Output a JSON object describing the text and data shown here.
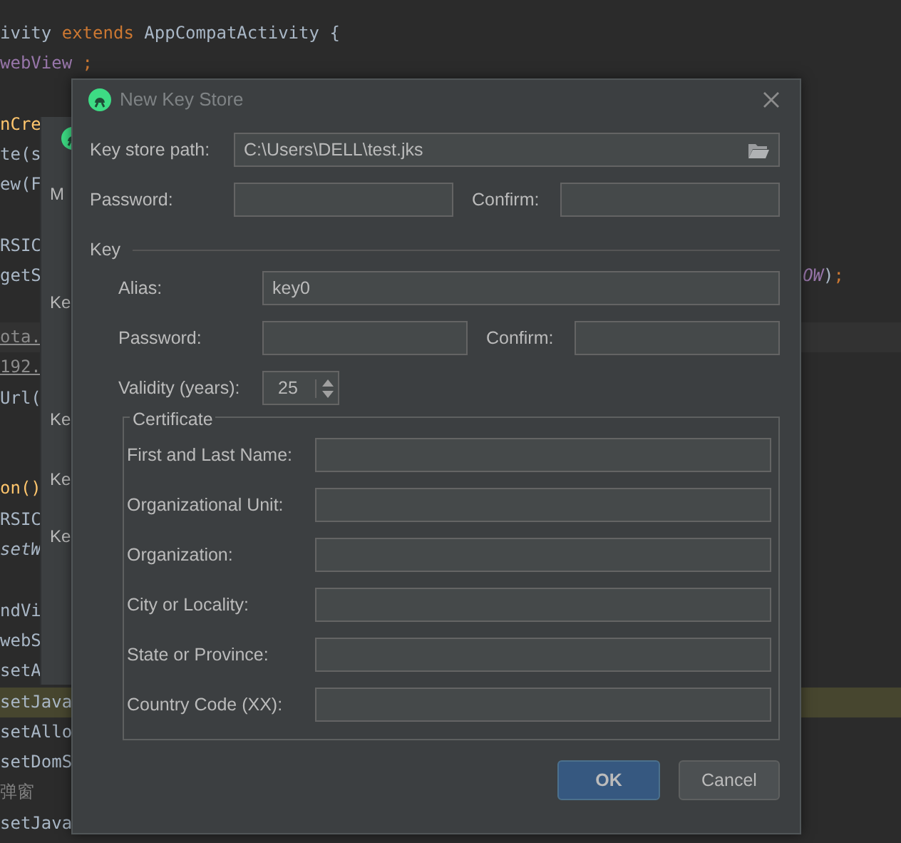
{
  "editor": {
    "lines": [
      {
        "kind": "code",
        "left": [
          {
            "text": "ivity ",
            "kind": "plain"
          },
          {
            "text": "extends",
            "kind": "keyword"
          },
          {
            "text": " AppCompatActivity {",
            "kind": "plain"
          }
        ]
      },
      {
        "kind": "code",
        "left": [
          {
            "text": "webView",
            "kind": "field"
          },
          {
            "text": " ;",
            "kind": "keyword"
          }
        ]
      },
      {
        "kind": "blank"
      },
      {
        "kind": "code",
        "left": [
          {
            "text": "nCre",
            "kind": "declaration"
          }
        ]
      },
      {
        "kind": "code",
        "left": [
          {
            "text": "te(s",
            "kind": "plain"
          }
        ]
      },
      {
        "kind": "code",
        "left": [
          {
            "text": "ew(F",
            "kind": "plain"
          }
        ]
      },
      {
        "kind": "blank"
      },
      {
        "kind": "code",
        "left": [
          {
            "text": "RSIC",
            "kind": "plain"
          }
        ]
      },
      {
        "kind": "code",
        "left": [
          {
            "text": "getS",
            "kind": "plain"
          }
        ],
        "right": [
          {
            "text": "OW",
            "kind": "constant"
          },
          {
            "text": ")",
            "kind": "plain"
          },
          {
            "text": ";",
            "kind": "keyword"
          }
        ]
      },
      {
        "kind": "blank"
      },
      {
        "kind": "current_line",
        "left": [
          {
            "text": "ota.",
            "kind": "link"
          }
        ]
      },
      {
        "kind": "code",
        "left": [
          {
            "text": "192.",
            "kind": "link"
          }
        ]
      },
      {
        "kind": "code",
        "left": [
          {
            "text": "Url(",
            "kind": "plain"
          }
        ]
      },
      {
        "kind": "blank"
      },
      {
        "kind": "blank"
      },
      {
        "kind": "code",
        "left": [
          {
            "text": "on()",
            "kind": "declaration"
          }
        ]
      },
      {
        "kind": "code",
        "left": [
          {
            "text": "RSIC",
            "kind": "plain"
          }
        ]
      },
      {
        "kind": "code",
        "left": [
          {
            "text": "setW",
            "kind": "call"
          }
        ]
      },
      {
        "kind": "blank"
      },
      {
        "kind": "code",
        "left": [
          {
            "text": "ndVi",
            "kind": "plain"
          }
        ]
      },
      {
        "kind": "code",
        "left": [
          {
            "text": "webS",
            "kind": "plain"
          }
        ]
      },
      {
        "kind": "code",
        "left": [
          {
            "text": "setA",
            "kind": "plain"
          }
        ]
      },
      {
        "kind": "match_line",
        "left": [
          {
            "text": "setJava",
            "kind": "plain"
          }
        ]
      },
      {
        "kind": "code",
        "left": [
          {
            "text": "setAllo",
            "kind": "plain"
          }
        ]
      },
      {
        "kind": "code",
        "left": [
          {
            "text": "setDomS",
            "kind": "plain"
          }
        ]
      },
      {
        "kind": "code",
        "left": [
          {
            "text": "弹窗",
            "kind": "comment"
          }
        ]
      },
      {
        "kind": "code",
        "left": [
          {
            "text": "setJava",
            "kind": "plain"
          }
        ]
      }
    ]
  },
  "background_dialog": {
    "labels": [
      "M",
      "Ke",
      "Ke",
      "Ke",
      "Ke"
    ]
  },
  "dialog": {
    "title": "New Key Store",
    "keystore_path": {
      "label": "Key store path:",
      "value": "C:\\Users\\DELL\\test.jks"
    },
    "password": {
      "label": "Password:"
    },
    "confirm": {
      "label": "Confirm:"
    },
    "key": {
      "title": "Key",
      "alias": {
        "label": "Alias:",
        "value": "key0"
      },
      "password": {
        "label": "Password:"
      },
      "confirm": {
        "label": "Confirm:"
      },
      "validity": {
        "label": "Validity (years):",
        "value": "25"
      },
      "certificate": {
        "title": "Certificate",
        "fields": [
          {
            "label": "First and Last Name:"
          },
          {
            "label": "Organizational Unit:"
          },
          {
            "label": "Organization:"
          },
          {
            "label": "City or Locality:"
          },
          {
            "label": "State or Province:"
          },
          {
            "label": "Country Code (XX):"
          }
        ]
      }
    },
    "buttons": [
      {
        "label": "OK",
        "kind": "primary"
      },
      {
        "label": "Cancel",
        "kind": "secondary"
      }
    ]
  }
}
